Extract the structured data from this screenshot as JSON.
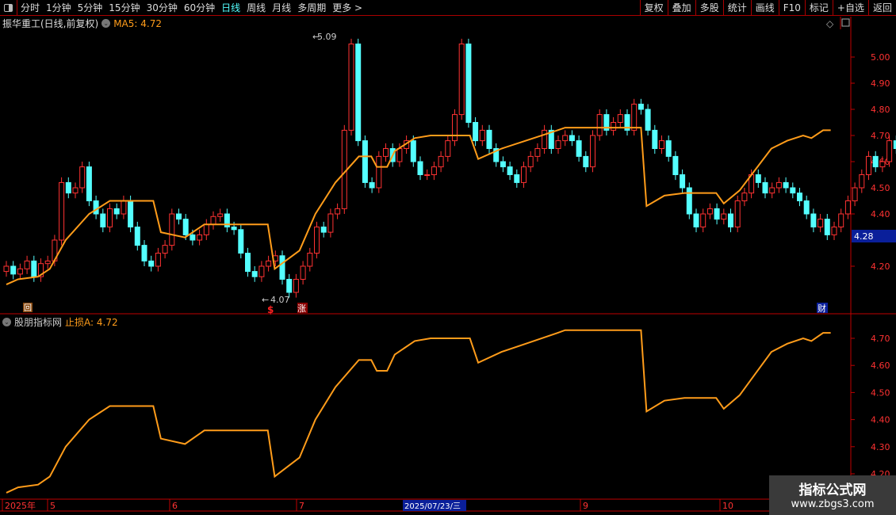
{
  "toolbar": {
    "periods": [
      "分时",
      "1分钟",
      "5分钟",
      "15分钟",
      "30分钟",
      "60分钟",
      "日线",
      "周线",
      "月线",
      "多周期",
      "更多 >"
    ],
    "active": "日线",
    "right_buttons": [
      "复权",
      "叠加",
      "多股",
      "统计",
      "画线",
      "F10",
      "标记",
      "+自选",
      "返回"
    ]
  },
  "main": {
    "stock_title": "振华重工(日线,前复权)",
    "ma_label": "MA5: 4.72",
    "high_marker": "5.09",
    "low_marker": "4.07",
    "current_price": "4.28",
    "price_ticks": [
      "5.00",
      "4.90",
      "4.80",
      "4.70",
      "4.60",
      "4.50",
      "4.40",
      "4.20"
    ],
    "badges": {
      "rise": "涨",
      "dollar": "$",
      "fin": "财",
      "square": "回"
    }
  },
  "indicator": {
    "name": "股朋指标网",
    "label": "止损A: 4.72",
    "ticks": [
      "4.70",
      "4.60",
      "4.50",
      "4.40",
      "4.30",
      "4.20"
    ]
  },
  "date_axis": {
    "labels": [
      "2025年",
      "5",
      "6",
      "7",
      "9",
      "10"
    ],
    "cursor_date": "2025/07/23/三"
  },
  "watermark": {
    "line1": "指标公式网",
    "line2": "www.zbgs3.com"
  },
  "colors": {
    "up": "#ff3232",
    "down": "#54ffff",
    "line": "#ff9c1a",
    "axis": "#c00000"
  },
  "chart_data": {
    "type": "candlestick",
    "closes": [
      4.2,
      4.17,
      4.19,
      4.22,
      4.16,
      4.21,
      4.22,
      4.3,
      4.52,
      4.48,
      4.5,
      4.58,
      4.45,
      4.4,
      4.35,
      4.42,
      4.4,
      4.45,
      4.35,
      4.28,
      4.22,
      4.2,
      4.25,
      4.28,
      4.4,
      4.38,
      4.32,
      4.3,
      4.32,
      4.36,
      4.39,
      4.4,
      4.35,
      4.34,
      4.25,
      4.18,
      4.16,
      4.2,
      4.22,
      4.24,
      4.15,
      4.1,
      4.15,
      4.2,
      4.25,
      4.35,
      4.33,
      4.4,
      4.42,
      4.72,
      5.05,
      4.68,
      4.52,
      4.5,
      4.62,
      4.65,
      4.6,
      4.65,
      4.68,
      4.6,
      4.55,
      4.55,
      4.58,
      4.62,
      4.68,
      4.78,
      5.05,
      4.75,
      4.68,
      4.72,
      4.65,
      4.6,
      4.58,
      4.55,
      4.52,
      4.58,
      4.62,
      4.65,
      4.72,
      4.65,
      4.68,
      4.7,
      4.68,
      4.62,
      4.58,
      4.7,
      4.78,
      4.72,
      4.75,
      4.78,
      4.72,
      4.82,
      4.8,
      4.72,
      4.65,
      4.68,
      4.62,
      4.55,
      4.5,
      4.4,
      4.35,
      4.4,
      4.42,
      4.38,
      4.4,
      4.35,
      4.45,
      4.48,
      4.55,
      4.52,
      4.48,
      4.5,
      4.52,
      4.5,
      4.48,
      4.45,
      4.4,
      4.35,
      4.38,
      4.32,
      4.35,
      4.4,
      4.45,
      4.5,
      4.55,
      4.62,
      4.58,
      4.6,
      4.68,
      4.65,
      4.72,
      4.68,
      4.65,
      4.7,
      4.85,
      4.82,
      4.75,
      4.7,
      4.72,
      4.68,
      4.65,
      4.7,
      4.72,
      4.75,
      4.8
    ],
    "stop_line": [
      [
        0,
        4.13
      ],
      [
        1.7,
        4.15
      ],
      [
        4.6,
        4.16
      ],
      [
        6.3,
        4.19
      ],
      [
        8.6,
        4.3
      ],
      [
        12,
        4.4
      ],
      [
        15,
        4.45
      ],
      [
        21.3,
        4.45
      ],
      [
        22.4,
        4.33
      ],
      [
        25.9,
        4.31
      ],
      [
        28.7,
        4.36
      ],
      [
        37.9,
        4.36
      ],
      [
        38.9,
        4.19
      ],
      [
        42.5,
        4.26
      ],
      [
        44.8,
        4.4
      ],
      [
        47.7,
        4.52
      ],
      [
        51.1,
        4.62
      ],
      [
        52.9,
        4.62
      ],
      [
        53.7,
        4.58
      ],
      [
        55.2,
        4.58
      ],
      [
        56.3,
        4.64
      ],
      [
        59.2,
        4.69
      ],
      [
        61.5,
        4.7
      ],
      [
        67.2,
        4.7
      ],
      [
        68.4,
        4.61
      ],
      [
        71.8,
        4.65
      ],
      [
        75.3,
        4.68
      ],
      [
        79.9,
        4.72
      ],
      [
        81,
        4.73
      ],
      [
        92,
        4.73
      ],
      [
        92.8,
        4.43
      ],
      [
        95.4,
        4.47
      ],
      [
        98.3,
        4.48
      ],
      [
        102.9,
        4.48
      ],
      [
        104,
        4.44
      ],
      [
        106.3,
        4.49
      ],
      [
        108.6,
        4.57
      ],
      [
        110.9,
        4.65
      ],
      [
        113.2,
        4.68
      ],
      [
        115.5,
        4.7
      ],
      [
        116.7,
        4.69
      ],
      [
        118.4,
        4.72
      ],
      [
        119.5,
        4.72
      ]
    ],
    "main_ylim": [
      4.1,
      5.1
    ],
    "indicator_ylim": [
      4.18,
      4.76
    ]
  }
}
